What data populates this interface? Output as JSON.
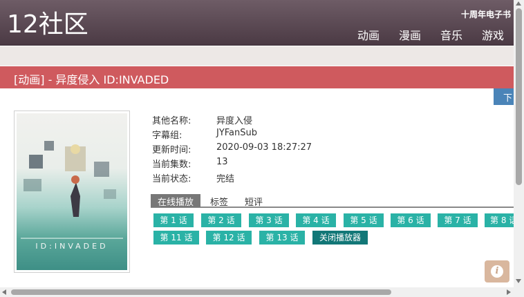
{
  "site": {
    "logo": "12社区",
    "tagline": "十周年电子书",
    "nav": [
      "动画",
      "漫画",
      "音乐",
      "游戏"
    ]
  },
  "page_title": "[动画] - 异度侵入 ID:INVADED",
  "download_button": "下",
  "poster": {
    "text": "ID:INVADED"
  },
  "info": [
    {
      "key": "其他名称:",
      "value": "异度入侵"
    },
    {
      "key": "字幕组:",
      "value": "JYFanSub"
    },
    {
      "key": "更新时间:",
      "value": "2020-09-03 18:27:27"
    },
    {
      "key": "当前集数:",
      "value": "13"
    },
    {
      "key": "当前状态:",
      "value": "完结"
    }
  ],
  "tabs": [
    "在线播放",
    "标签",
    "短评"
  ],
  "episodes": [
    "第 1 话",
    "第 2 话",
    "第 3 话",
    "第 4 话",
    "第 5 话",
    "第 6 话",
    "第 7 话",
    "第 8 话",
    "第 11 话",
    "第 12 话",
    "第 13 话"
  ],
  "close_player": "关闭播放器",
  "info_icon": "i",
  "colors": {
    "header": "#5e4c56",
    "title_bar": "#cf5a5e",
    "episode_button": "#2ab2a6",
    "close_button": "#127777",
    "download_button": "#4a84b8"
  }
}
